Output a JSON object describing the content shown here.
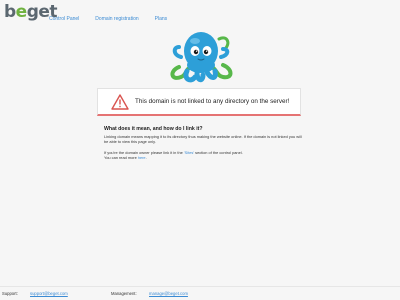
{
  "header": {
    "logo_part1": "b",
    "logo_part2": "e",
    "logo_part3": "get",
    "nav": [
      "Control Panel",
      "Domain registration",
      "Plans"
    ]
  },
  "alert": {
    "message": "This domain is not linked to any directory on the server!",
    "accent_color": "#e57373"
  },
  "info": {
    "heading": "What does it mean, and how do I link it?",
    "para1": "Linking domain means mapping it to its directory thus making the website online. If the domain is not linked you will be able to view this page only.",
    "para2_before": "If you're the domain owner please link it in the ",
    "para2_link": "'Sites'",
    "para2_after": " section of the control panel.",
    "para3_before": "You can read more ",
    "para3_link": "here",
    "para3_after": "."
  },
  "footer": {
    "support_label": "Support:",
    "support_email": "support@beget.com",
    "management_label": "Management:",
    "management_email": "manage@beget.com"
  },
  "colors": {
    "link": "#3b8bd4",
    "logo_grey": "#5b6770",
    "logo_green": "#6fb23f"
  }
}
